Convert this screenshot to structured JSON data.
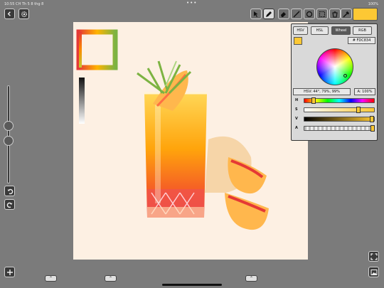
{
  "status_bar": {
    "time_date": "10:55 CH  Th 5 8 thg 8",
    "dots": "•••",
    "battery": "100%"
  },
  "left_controls": {
    "back_icon": "back-arrow-icon",
    "settings_icon": "gear-icon",
    "undo_icon": "undo-icon",
    "redo_icon": "redo-icon",
    "add_icon": "plus-icon"
  },
  "tools": [
    {
      "name": "select-tool",
      "icon": "cursor-icon"
    },
    {
      "name": "pencil-tool",
      "icon": "pencil-icon",
      "selected": true
    },
    {
      "name": "eraser-tool",
      "icon": "eraser-icon"
    },
    {
      "name": "line-tool",
      "icon": "line-icon"
    },
    {
      "name": "ellipse-tool",
      "icon": "circle-icon"
    },
    {
      "name": "selection-tool",
      "icon": "marquee-icon"
    },
    {
      "name": "fill-tool",
      "icon": "bucket-icon"
    },
    {
      "name": "eyedropper-tool",
      "icon": "eyedropper-icon"
    }
  ],
  "current_color": "#FDC834",
  "color_picker": {
    "tabs": [
      "HSV",
      "HSL",
      "Wheel",
      "RGB"
    ],
    "active_tab": "Wheel",
    "hex": "# FDC834",
    "hsv_readout": "HSV:   44°, 79%, 99%",
    "alpha_readout": "A: 100%",
    "channels": [
      {
        "label": "H",
        "value": 0.12
      },
      {
        "label": "S",
        "value": 0.79
      },
      {
        "label": "V",
        "value": 0.99
      },
      {
        "label": "A",
        "value": 1.0
      }
    ]
  },
  "bottom": {
    "fullscreen_icon": "fullscreen-icon",
    "gallery_icon": "image-icon",
    "chevron": "⌃"
  }
}
